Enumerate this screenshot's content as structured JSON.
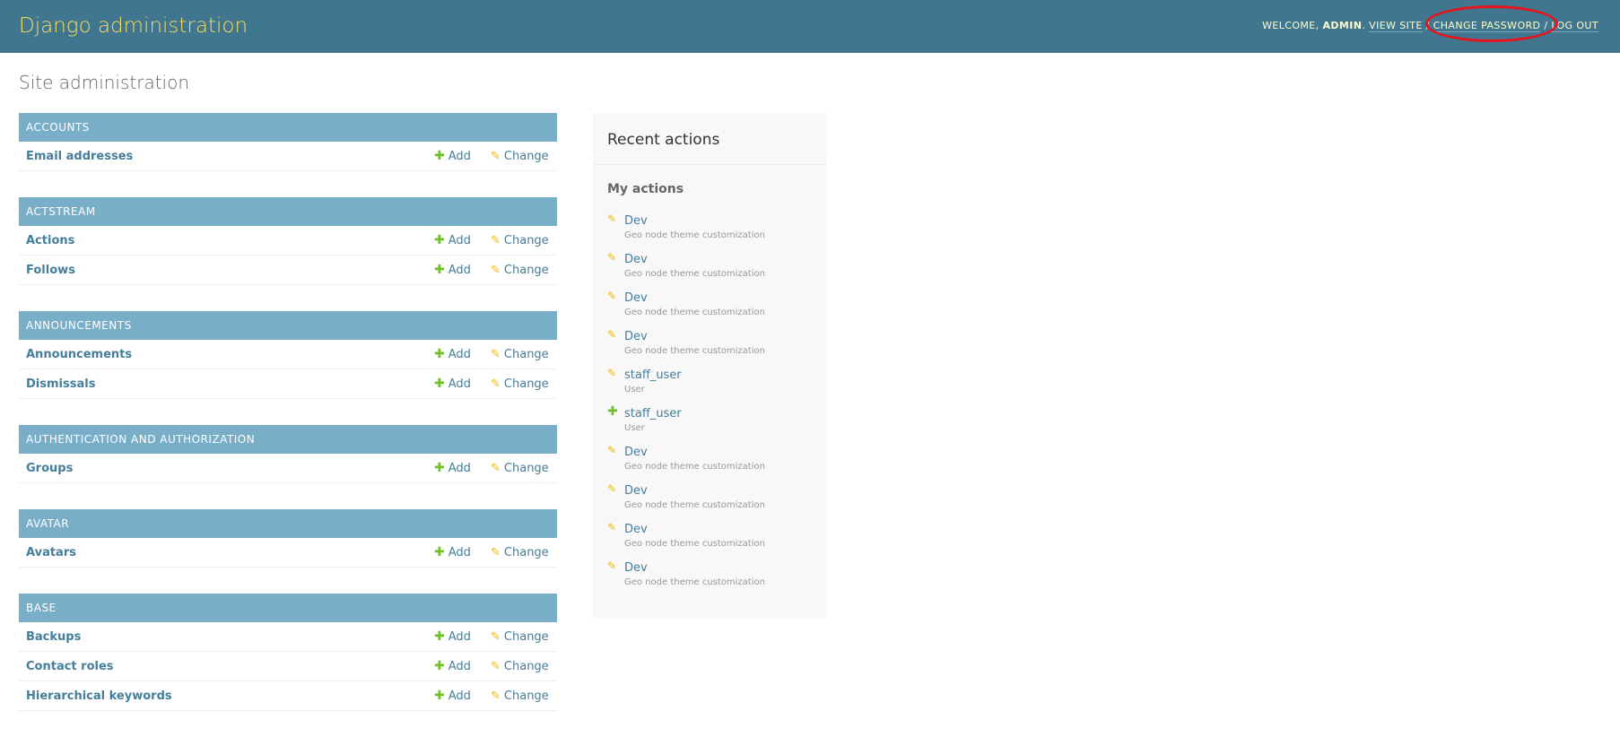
{
  "header": {
    "site_name": "Django administration",
    "welcome_label": "Welcome,",
    "username": "admin",
    "view_site": "View site",
    "change_password": "Change password",
    "log_out": "Log out",
    "separator": "/"
  },
  "page_title": "Site administration",
  "apps": [
    {
      "caption": "Accounts",
      "models": [
        {
          "name": "Email addresses",
          "add": "Add",
          "change": "Change"
        }
      ]
    },
    {
      "caption": "Actstream",
      "models": [
        {
          "name": "Actions",
          "add": "Add",
          "change": "Change"
        },
        {
          "name": "Follows",
          "add": "Add",
          "change": "Change"
        }
      ]
    },
    {
      "caption": "Announcements",
      "models": [
        {
          "name": "Announcements",
          "add": "Add",
          "change": "Change"
        },
        {
          "name": "Dismissals",
          "add": "Add",
          "change": "Change"
        }
      ]
    },
    {
      "caption": "Authentication and Authorization",
      "models": [
        {
          "name": "Groups",
          "add": "Add",
          "change": "Change"
        }
      ]
    },
    {
      "caption": "Avatar",
      "models": [
        {
          "name": "Avatars",
          "add": "Add",
          "change": "Change"
        }
      ]
    },
    {
      "caption": "Base",
      "models": [
        {
          "name": "Backups",
          "add": "Add",
          "change": "Change"
        },
        {
          "name": "Contact roles",
          "add": "Add",
          "change": "Change"
        },
        {
          "name": "Hierarchical keywords",
          "add": "Add",
          "change": "Change"
        }
      ]
    }
  ],
  "recent_actions": {
    "title": "Recent actions",
    "my_actions_label": "My actions",
    "items": [
      {
        "icon": "pencil-icon",
        "name": "Dev",
        "type": "Geo node theme customization"
      },
      {
        "icon": "pencil-icon",
        "name": "Dev",
        "type": "Geo node theme customization"
      },
      {
        "icon": "pencil-icon",
        "name": "Dev",
        "type": "Geo node theme customization"
      },
      {
        "icon": "pencil-icon",
        "name": "Dev",
        "type": "Geo node theme customization"
      },
      {
        "icon": "pencil-icon",
        "name": "staff_user",
        "type": "User"
      },
      {
        "icon": "plus-icon",
        "name": "staff_user",
        "type": "User"
      },
      {
        "icon": "pencil-icon",
        "name": "Dev",
        "type": "Geo node theme customization"
      },
      {
        "icon": "pencil-icon",
        "name": "Dev",
        "type": "Geo node theme customization"
      },
      {
        "icon": "pencil-icon",
        "name": "Dev",
        "type": "Geo node theme customization"
      },
      {
        "icon": "pencil-icon",
        "name": "Dev",
        "type": "Geo node theme customization"
      }
    ]
  },
  "colors": {
    "header_bg": "#417690",
    "brand_yellow": "#f5dd5d",
    "module_caption_bg": "#79aec8",
    "link": "#447e9b",
    "add_green": "#70bf2b",
    "change_yellow": "#efb80b",
    "annotation_red": "#e4151b"
  }
}
